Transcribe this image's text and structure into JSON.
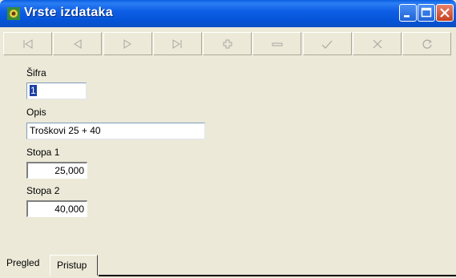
{
  "window": {
    "title": "Vrste izdataka"
  },
  "toolbar": {
    "buttons": [
      "first-icon",
      "prior-icon",
      "next-icon",
      "last-icon",
      "insert-icon",
      "delete-icon",
      "post-icon",
      "cancel-icon",
      "refresh-icon"
    ]
  },
  "form": {
    "sifra_label": "Šifra",
    "sifra_value": "1",
    "opis_label": "Opis",
    "opis_value": "Troškovi 25 + 40",
    "stopa1_label": "Stopa 1",
    "stopa1_value": "25,000",
    "stopa2_label": "Stopa 2",
    "stopa2_value": "40,000"
  },
  "tabs": [
    {
      "label": "Pregled"
    },
    {
      "label": "Pristup"
    }
  ],
  "colors": {
    "titlebar": "#0554d8",
    "window_bg": "#ece9d8",
    "selection": "#1c3fa5"
  }
}
